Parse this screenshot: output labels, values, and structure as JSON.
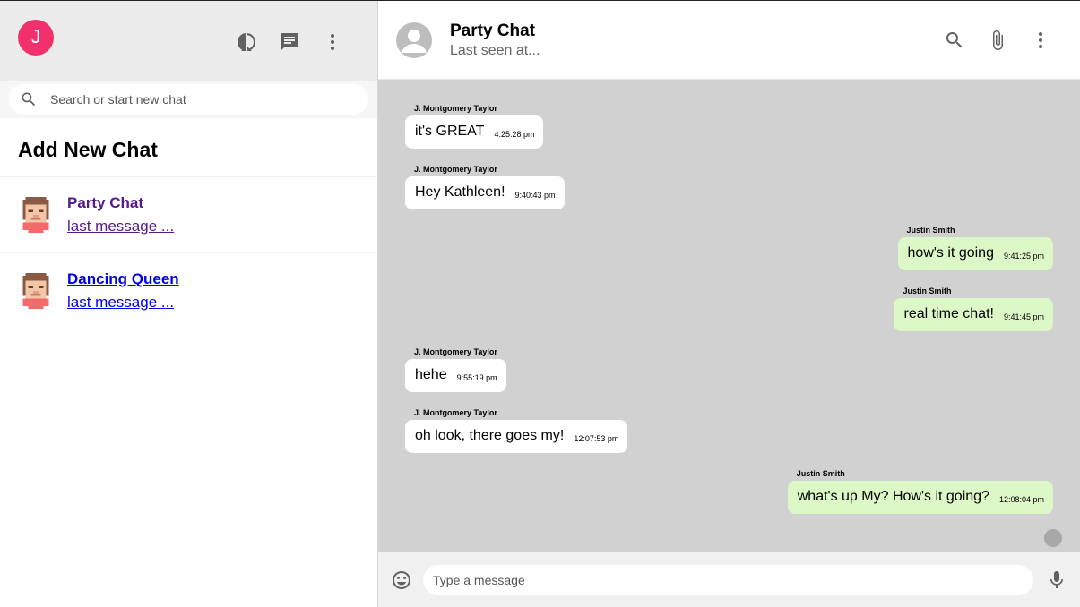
{
  "user": {
    "initial": "J",
    "avatar_color": "#f2306b"
  },
  "sidebar": {
    "icons": [
      "status-icon",
      "chat-icon",
      "more-vert-icon"
    ],
    "search_placeholder": "Search or start new chat",
    "add_new_label": "Add New Chat",
    "chats": [
      {
        "name": "Party Chat",
        "last_message": "last message ...",
        "visited": true
      },
      {
        "name": "Dancing Queen",
        "last_message": "last message ...",
        "visited": false
      }
    ]
  },
  "chat": {
    "title": "Party Chat",
    "subtitle": "Last seen at...",
    "header_icons": [
      "search-icon",
      "attach-icon",
      "more-vert-icon"
    ],
    "messages": [
      {
        "sender": "J. Montgomery Taylor",
        "text": "it's GREAT",
        "time": "4:25:28 pm",
        "mine": false
      },
      {
        "sender": "J. Montgomery Taylor",
        "text": "Hey Kathleen!",
        "time": "9:40:43 pm",
        "mine": false
      },
      {
        "sender": "Justin Smith",
        "text": "how's it going",
        "time": "9:41:25 pm",
        "mine": true
      },
      {
        "sender": "Justin Smith",
        "text": "real time chat!",
        "time": "9:41:45 pm",
        "mine": true
      },
      {
        "sender": "J. Montgomery Taylor",
        "text": "hehe",
        "time": "9:55:19 pm",
        "mine": false
      },
      {
        "sender": "J. Montgomery Taylor",
        "text": "oh look, there goes my!",
        "time": "12:07:53 pm",
        "mine": false
      },
      {
        "sender": "Justin Smith",
        "text": "what's up My? How's it going?",
        "time": "12:08:04 pm",
        "mine": true
      }
    ],
    "received_color": "#ffffff",
    "sent_color": "#dcf8c6",
    "background_color": "#d1d1d1"
  },
  "composer": {
    "placeholder": "Type a message",
    "icons": [
      "emoji-icon",
      "mic-icon"
    ]
  }
}
